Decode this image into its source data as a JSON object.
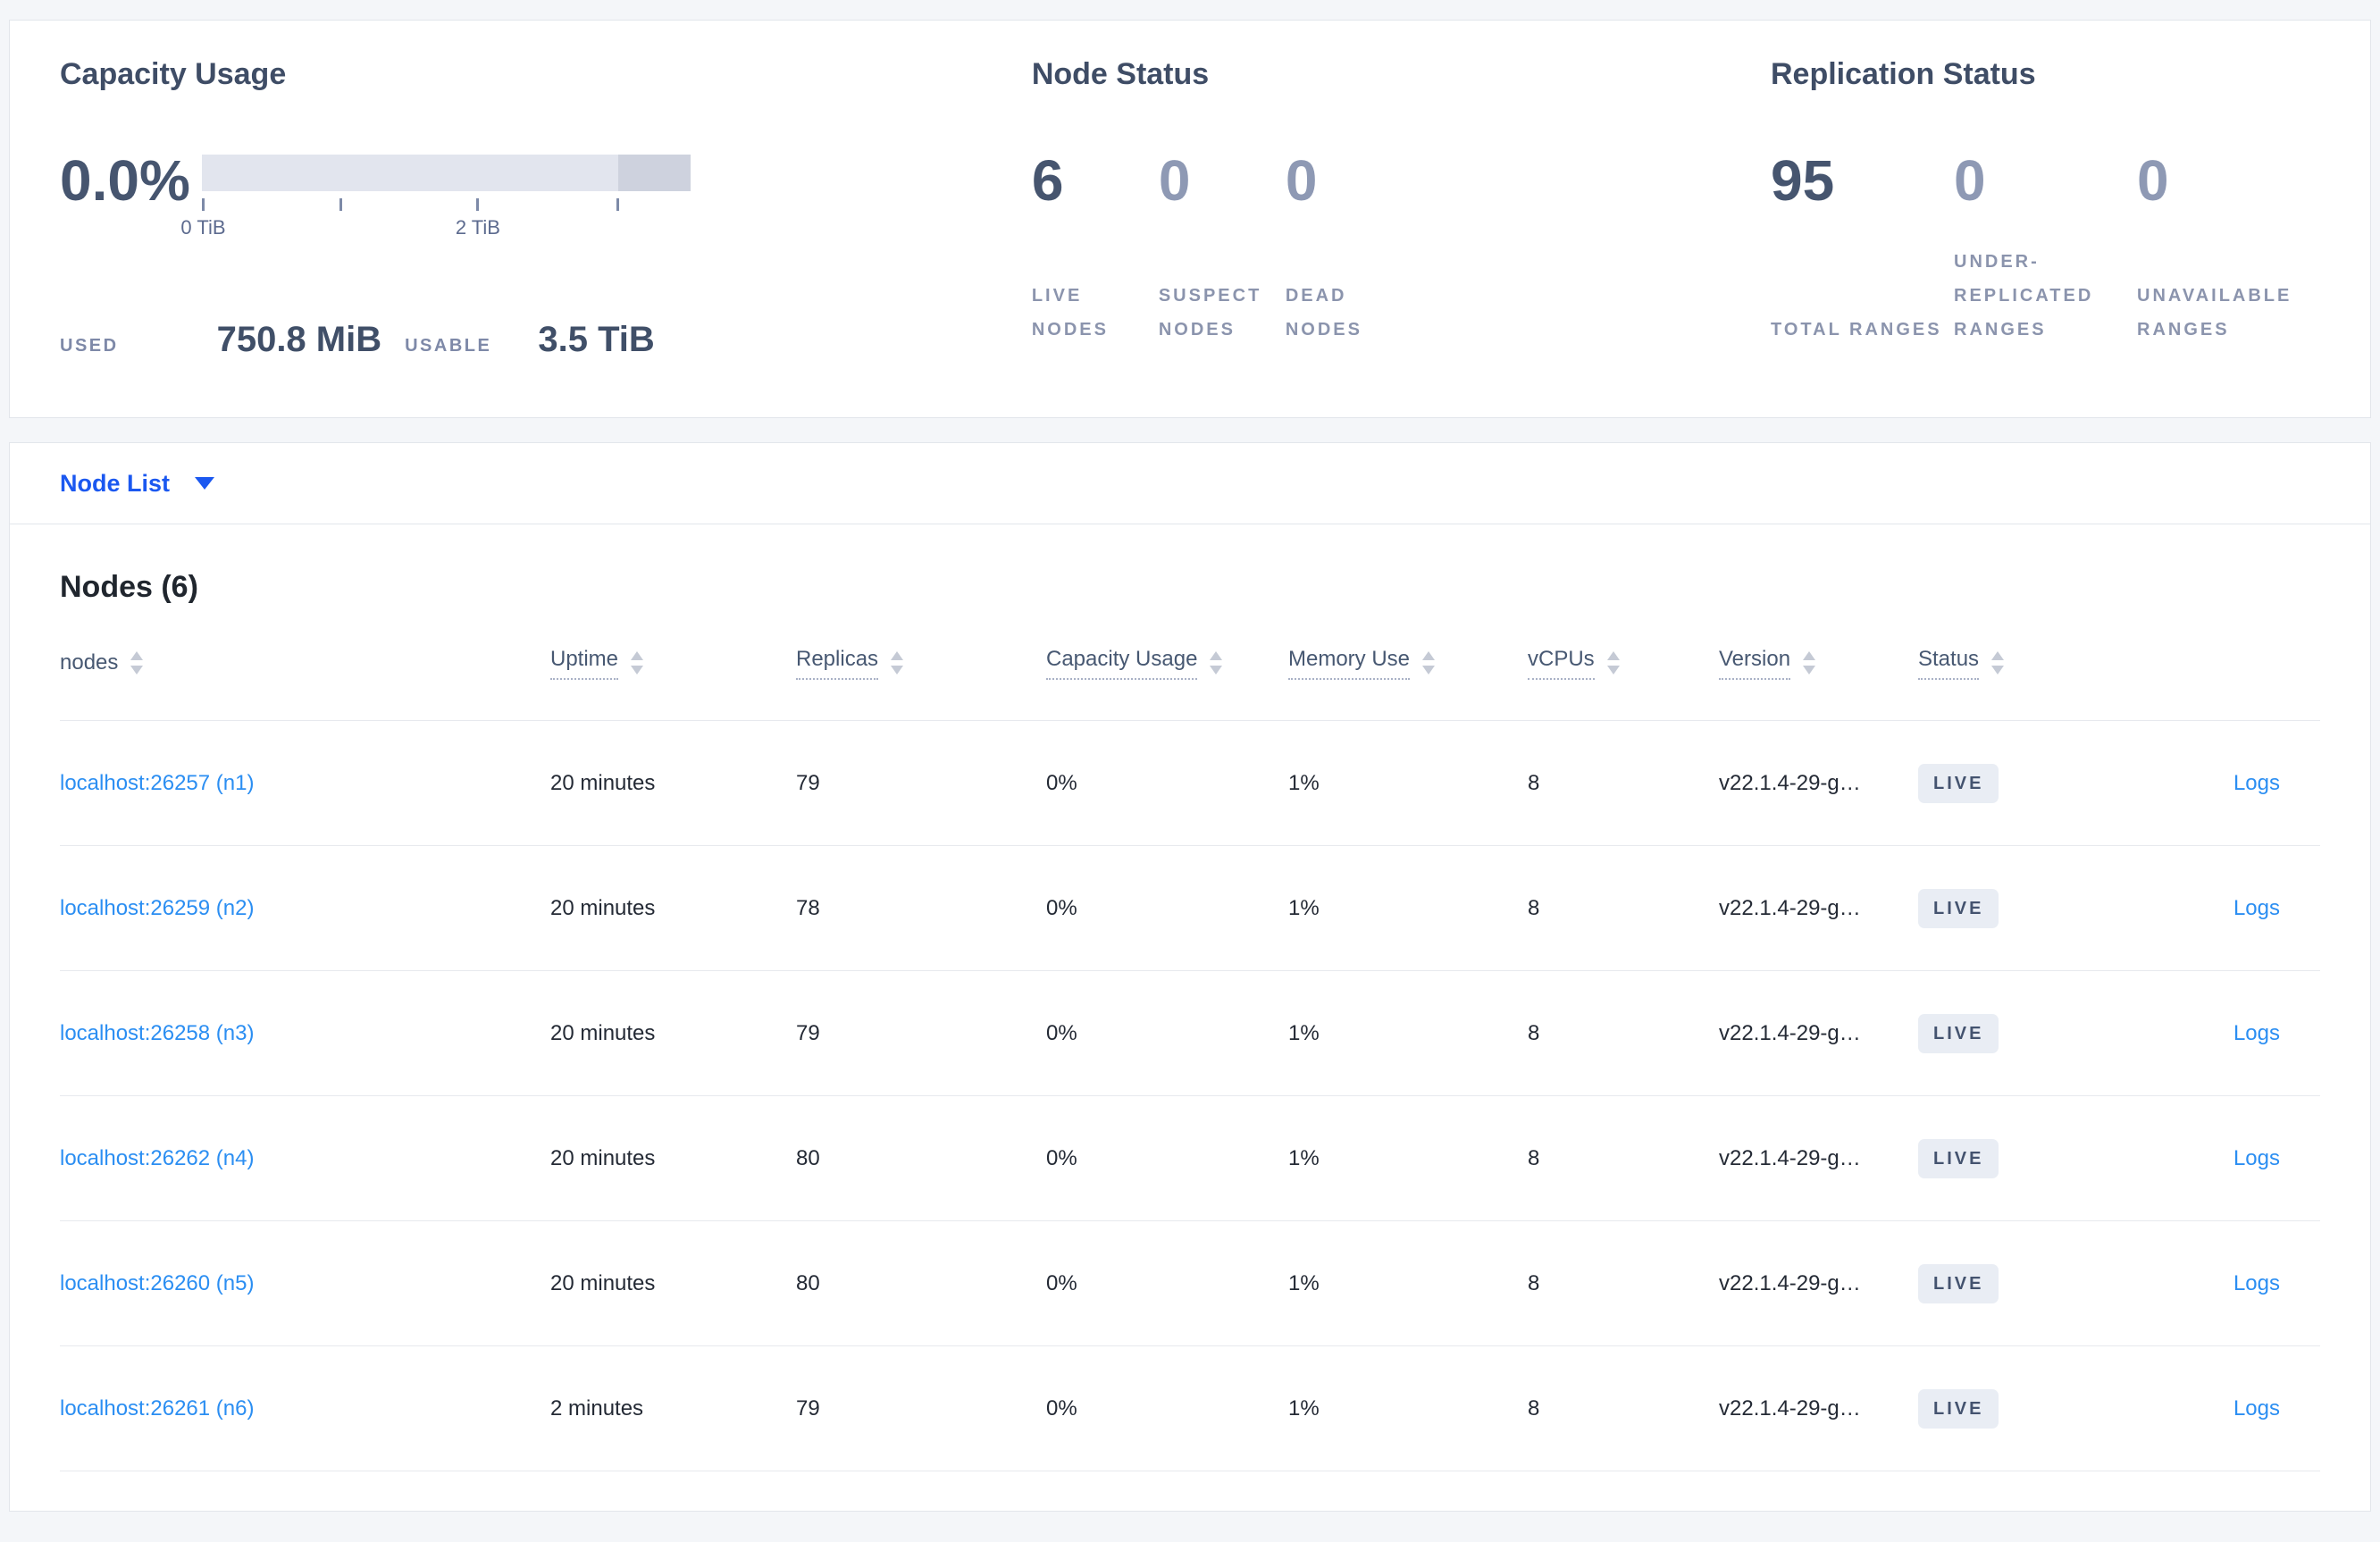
{
  "summary": {
    "capacity": {
      "title": "Capacity Usage",
      "percent": "0.0%",
      "bar": {
        "light_pct": 85.2,
        "dark_pct": 14.8
      },
      "ticks": [
        {
          "pos": 0,
          "label": "0 TiB"
        },
        {
          "pos": 28.2,
          "label": ""
        },
        {
          "pos": 56.2,
          "label": "2 TiB"
        },
        {
          "pos": 84.8,
          "label": ""
        }
      ],
      "used_label": "USED",
      "used_value": "750.8 MiB",
      "usable_label": "USABLE",
      "usable_value": "3.5 TiB"
    },
    "node_status": {
      "title": "Node Status",
      "stats": [
        {
          "value": "6",
          "label": "LIVE NODES"
        },
        {
          "value": "0",
          "label": "SUSPECT NODES"
        },
        {
          "value": "0",
          "label": "DEAD NODES"
        }
      ]
    },
    "replication": {
      "title": "Replication Status",
      "stats": [
        {
          "value": "95",
          "label": "TOTAL RANGES"
        },
        {
          "value": "0",
          "label": "UNDER-REPLICATED RANGES"
        },
        {
          "value": "0",
          "label": "UNAVAILABLE RANGES"
        }
      ]
    }
  },
  "view_selector": {
    "label": "Node List",
    "icon": "caret-down-icon"
  },
  "nodes": {
    "title": "Nodes (6)",
    "columns": [
      {
        "label": "nodes"
      },
      {
        "label": "Uptime"
      },
      {
        "label": "Replicas"
      },
      {
        "label": "Capacity Usage"
      },
      {
        "label": "Memory Use"
      },
      {
        "label": "vCPUs"
      },
      {
        "label": "Version"
      },
      {
        "label": "Status"
      }
    ],
    "rows": [
      {
        "node": "localhost:26257 (n1)",
        "uptime": "20 minutes",
        "replicas": "79",
        "capacity": "0%",
        "memory": "1%",
        "vcpus": "8",
        "version": "v22.1.4-29-g…",
        "status": "LIVE",
        "logs": "Logs"
      },
      {
        "node": "localhost:26259 (n2)",
        "uptime": "20 minutes",
        "replicas": "78",
        "capacity": "0%",
        "memory": "1%",
        "vcpus": "8",
        "version": "v22.1.4-29-g…",
        "status": "LIVE",
        "logs": "Logs"
      },
      {
        "node": "localhost:26258 (n3)",
        "uptime": "20 minutes",
        "replicas": "79",
        "capacity": "0%",
        "memory": "1%",
        "vcpus": "8",
        "version": "v22.1.4-29-g…",
        "status": "LIVE",
        "logs": "Logs"
      },
      {
        "node": "localhost:26262 (n4)",
        "uptime": "20 minutes",
        "replicas": "80",
        "capacity": "0%",
        "memory": "1%",
        "vcpus": "8",
        "version": "v22.1.4-29-g…",
        "status": "LIVE",
        "logs": "Logs"
      },
      {
        "node": "localhost:26260 (n5)",
        "uptime": "20 minutes",
        "replicas": "80",
        "capacity": "0%",
        "memory": "1%",
        "vcpus": "8",
        "version": "v22.1.4-29-g…",
        "status": "LIVE",
        "logs": "Logs"
      },
      {
        "node": "localhost:26261 (n6)",
        "uptime": "2 minutes",
        "replicas": "79",
        "capacity": "0%",
        "memory": "1%",
        "vcpus": "8",
        "version": "v22.1.4-29-g…",
        "status": "LIVE",
        "logs": "Logs"
      }
    ]
  },
  "colors": {
    "page_bg": "#f4f6f9",
    "link_blue": "#2b8ef2",
    "selector_blue": "#1b58f0",
    "heading_slate": "#3f4d66",
    "muted_stat": "#8e99b4",
    "badge_bg": "#e9edf4",
    "badge_text": "#44536f",
    "bar_light": "#e2e5ee",
    "bar_dark": "#ced2de"
  }
}
